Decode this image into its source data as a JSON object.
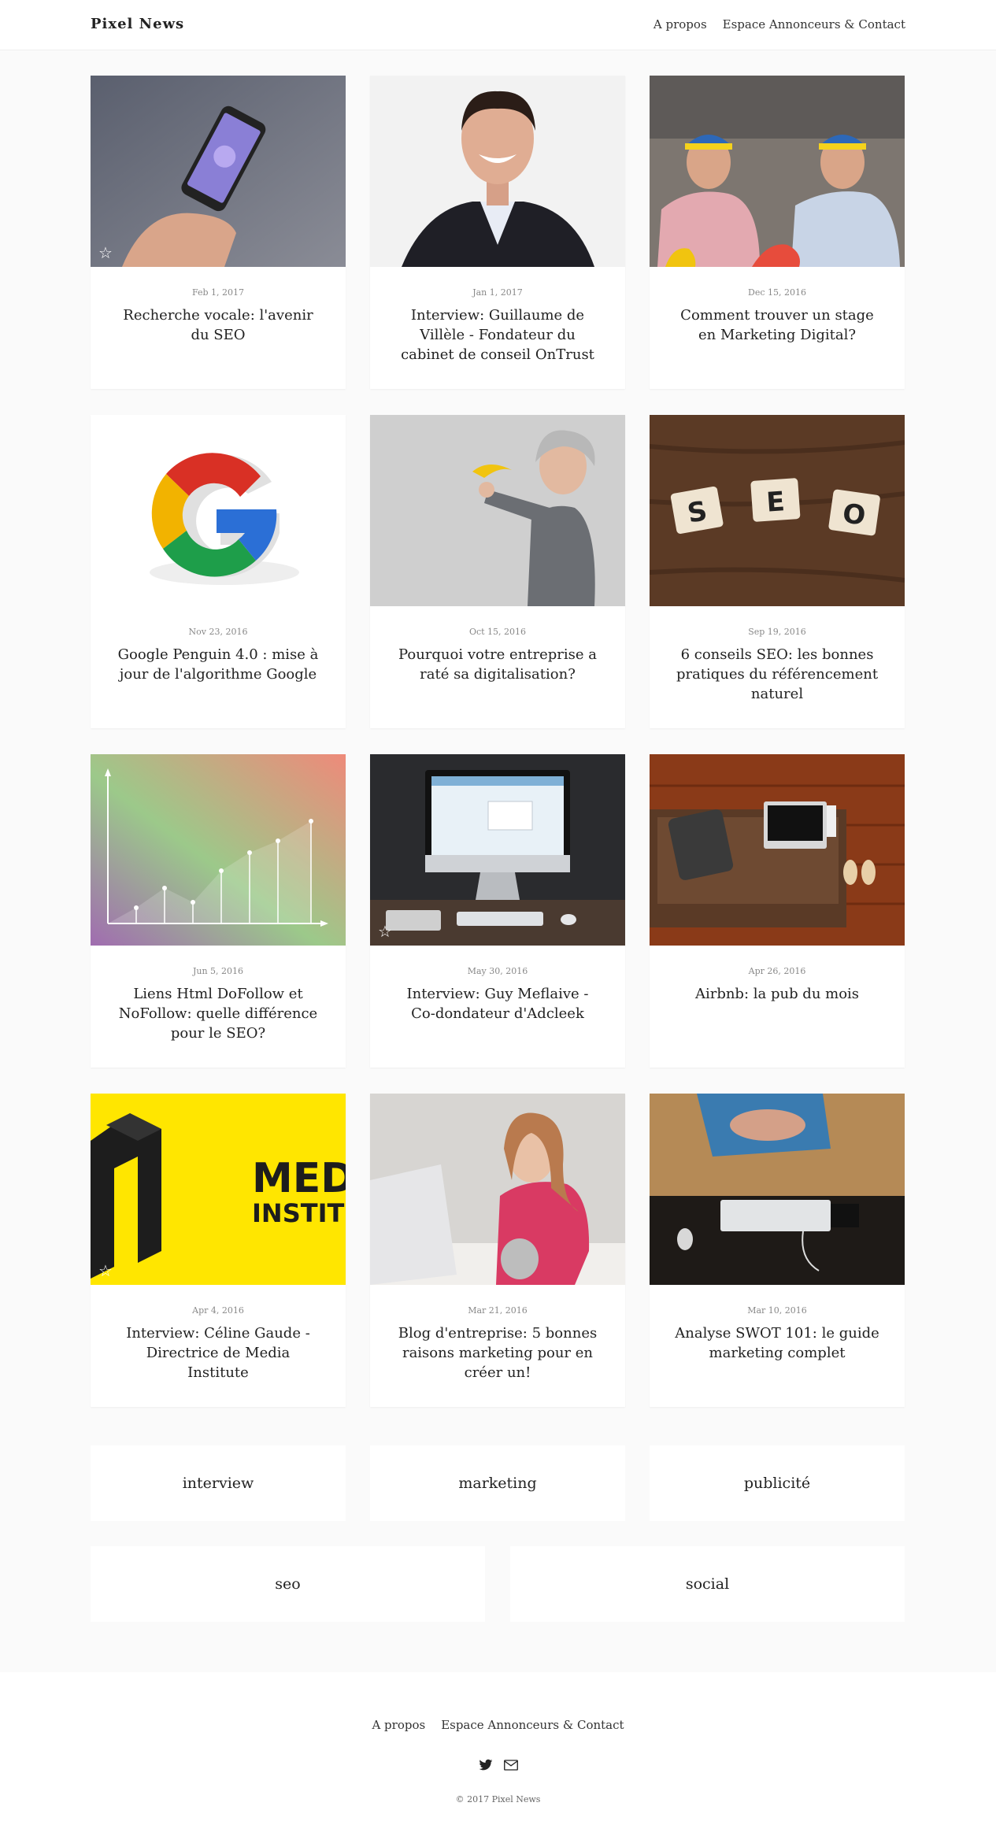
{
  "header": {
    "brand": "Pixel News",
    "nav": [
      "A propos",
      "Espace Annonceurs & Contact"
    ]
  },
  "posts": [
    {
      "date": "Feb 1, 2017",
      "title": "Recherche vocale: l'avenir du SEO",
      "image": "hand-holding-phone",
      "featured": true
    },
    {
      "date": "Jan 1, 2017",
      "title": "Interview: Guillaume de Villèle - Fondateur du cabinet de conseil OnTrust",
      "image": "smiling-man-portrait",
      "featured": false
    },
    {
      "date": "Dec 15, 2016",
      "title": "Comment trouver un stage en Marketing Digital?",
      "image": "interns-with-propeller-caps",
      "featured": false
    },
    {
      "date": "Nov 23, 2016",
      "title": "Google Penguin 4.0 : mise à jour de l'algorithme Google",
      "image": "google-g-logo",
      "featured": false
    },
    {
      "date": "Oct 15, 2016",
      "title": "Pourquoi votre entreprise a raté sa digitalisation?",
      "image": "man-holding-banana",
      "featured": false
    },
    {
      "date": "Sep 19, 2016",
      "title": "6 conseils SEO: les bonnes pratiques du référencement naturel",
      "image": "seo-scrabble-tiles",
      "featured": false
    },
    {
      "date": "Jun 5, 2016",
      "title": "Liens Html DoFollow et NoFollow: quelle différence pour le SEO?",
      "image": "growth-chart-gradient",
      "featured": false
    },
    {
      "date": "May 30, 2016",
      "title": "Interview: Guy Meflaive - Co-dondateur d'Adcleek",
      "image": "imac-desk",
      "featured": true
    },
    {
      "date": "Apr 26, 2016",
      "title": "Airbnb: la pub du mois",
      "image": "laptop-on-sofa",
      "featured": false
    },
    {
      "date": "Apr 4, 2016",
      "title": "Interview: Céline Gaude - Directrice de Media Institute",
      "image": "media-institute-logo",
      "featured": true,
      "image_text": [
        "MED",
        "INSTIT"
      ]
    },
    {
      "date": "Mar 21, 2016",
      "title": "Blog d'entreprise: 5 bonnes raisons marketing pour en créer un!",
      "image": "woman-laptop-coffee",
      "featured": false
    },
    {
      "date": "Mar 10, 2016",
      "title": "Analyse SWOT 101: le guide marketing complet",
      "image": "person-at-keyboard-desk",
      "featured": false
    }
  ],
  "tags": [
    "interview",
    "marketing",
    "publicité",
    "seo",
    "social"
  ],
  "footer": {
    "nav": [
      "A propos",
      "Espace Annonceurs & Contact"
    ],
    "icons": [
      "twitter-icon",
      "mail-icon"
    ],
    "copyright": "© 2017 Pixel News"
  },
  "colors": {
    "background": "#fafafa",
    "card": "#ffffff",
    "text": "#222222",
    "muted": "#888888",
    "media_yellow": "#ffe600"
  }
}
